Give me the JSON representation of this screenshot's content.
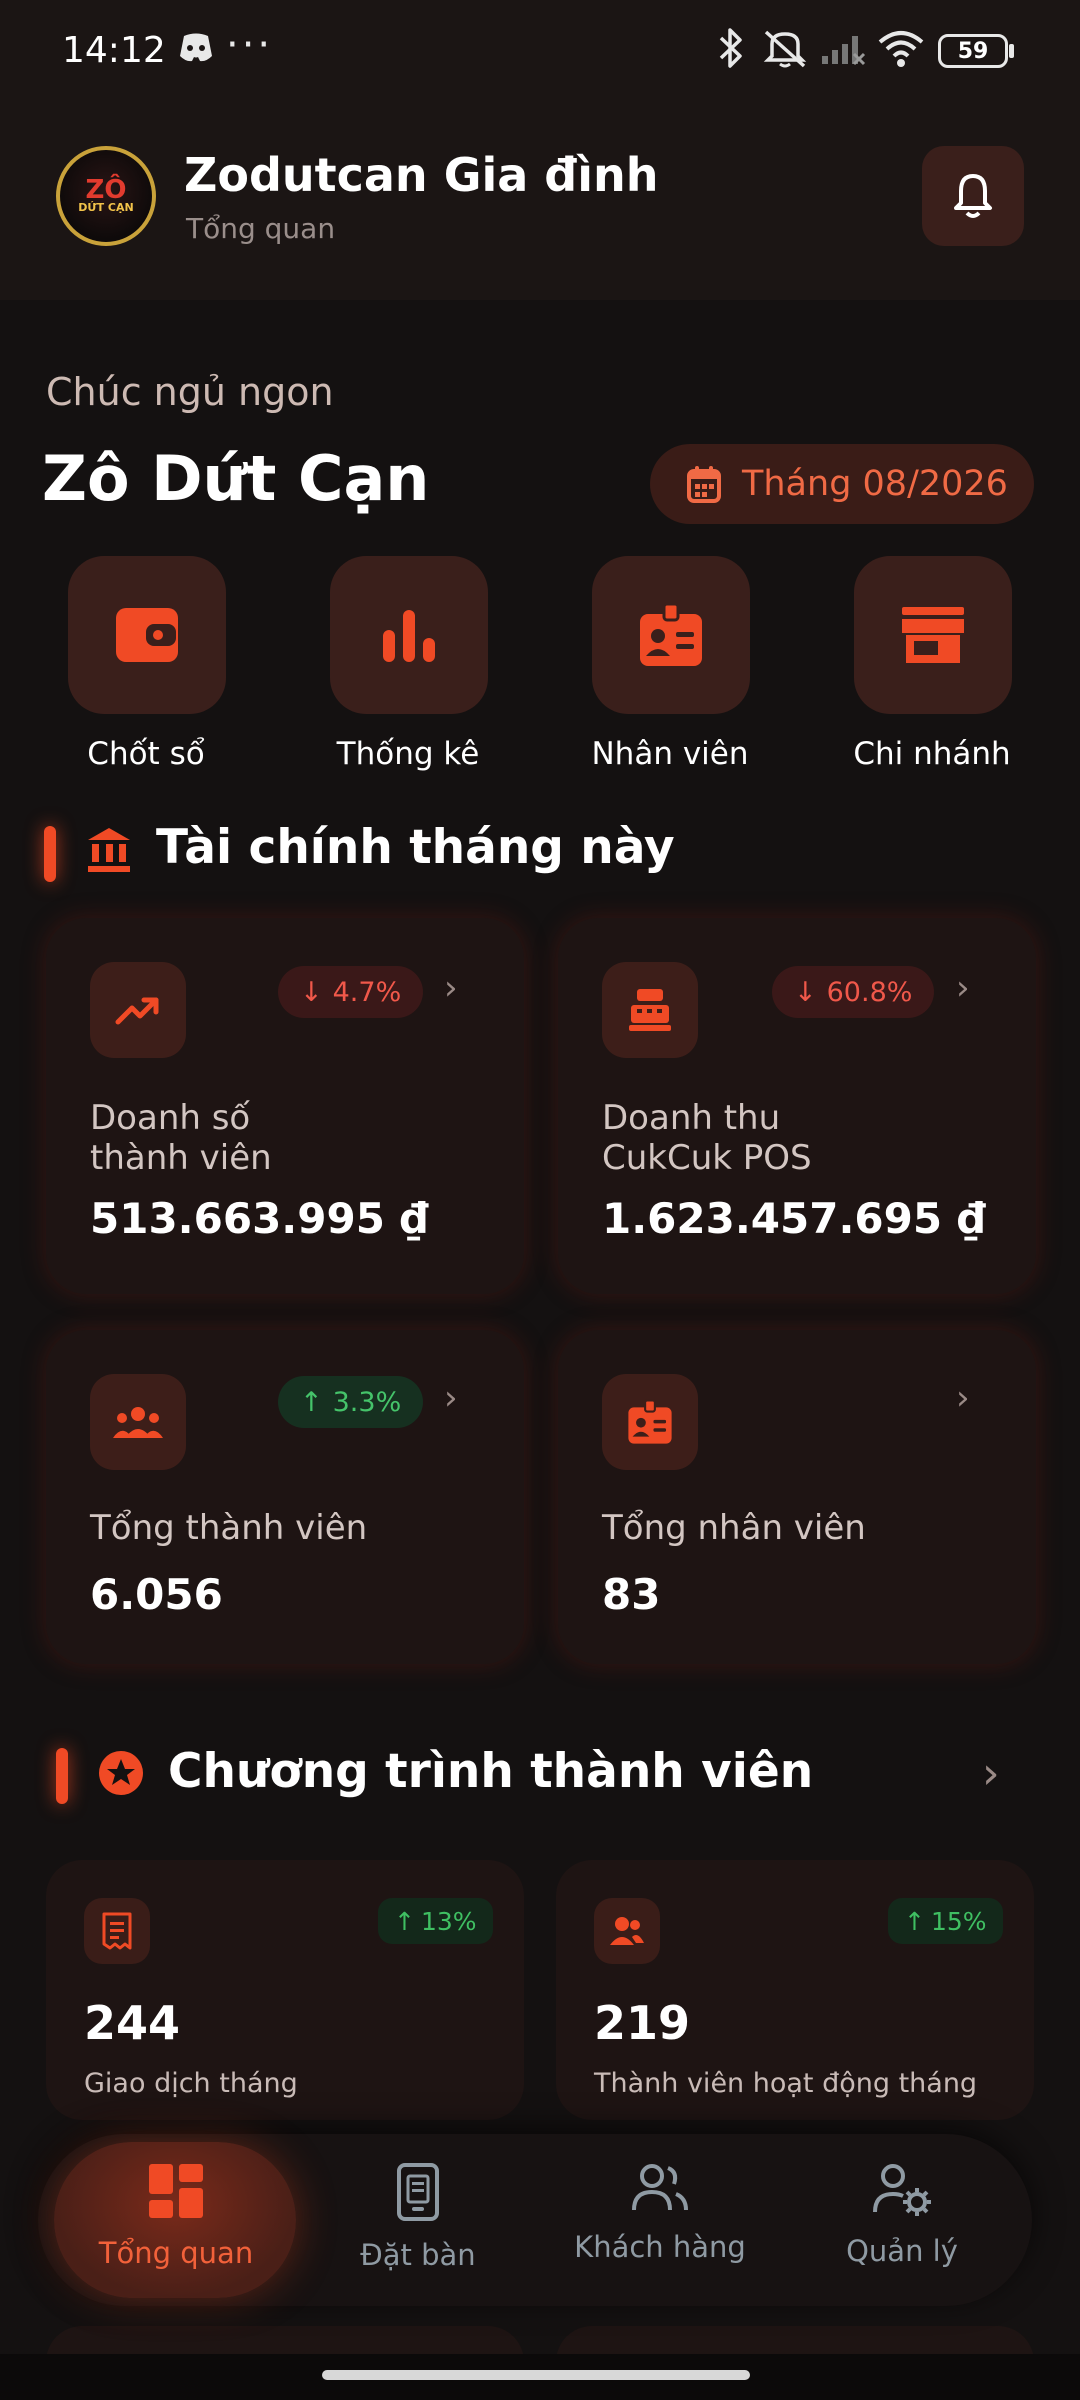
{
  "status_bar": {
    "time": "14:12",
    "left_icons": [
      "discord-icon",
      "more-dots-icon"
    ],
    "right_icons": [
      "bluetooth-icon",
      "mute-icon",
      "signal-icon",
      "wifi-icon",
      "battery-icon"
    ],
    "battery": "59"
  },
  "header": {
    "title": "Zodutcan Gia đình",
    "subtitle": "Tổng quan",
    "logo_text": "ZÔ",
    "logo_sub": "DỨT CẠN"
  },
  "greeting": {
    "text": "Chúc ngủ ngon",
    "name": "Zô Dứt Cạn",
    "month": "Tháng 08/2026"
  },
  "quick_actions": [
    {
      "label": "Chốt sổ",
      "icon": "wallet-icon"
    },
    {
      "label": "Thống kê",
      "icon": "bar-chart-icon"
    },
    {
      "label": "Nhân viên",
      "icon": "id-badge-icon"
    },
    {
      "label": "Chi nhánh",
      "icon": "store-icon"
    }
  ],
  "finance": {
    "title": "Tài chính tháng này",
    "cards": [
      {
        "label_1": "Doanh số",
        "label_2": "thành viên",
        "value": "513.663.995 ₫",
        "badge": "4.7%",
        "trend": "down",
        "icon": "trending-up-icon"
      },
      {
        "label_1": "Doanh thu",
        "label_2": "CukCuk POS",
        "value": "1.623.457.695 ₫",
        "badge": "60.8%",
        "trend": "down",
        "icon": "cash-register-icon"
      },
      {
        "label_1": "Tổng thành viên",
        "label_2": "",
        "value": "6.056",
        "badge": "3.3%",
        "trend": "up",
        "icon": "group-icon"
      },
      {
        "label_1": "Tổng nhân viên",
        "label_2": "",
        "value": "83",
        "badge": "",
        "trend": "",
        "icon": "id-badge-icon"
      }
    ]
  },
  "program": {
    "title": "Chương trình thành viên",
    "cards": [
      {
        "value": "244",
        "label": "Giao dịch tháng",
        "badge": "13%",
        "icon": "receipt-icon"
      },
      {
        "value": "219",
        "label": "Thành viên hoạt động tháng",
        "badge": "15%",
        "icon": "users-icon"
      }
    ]
  },
  "nav": {
    "items": [
      {
        "label": "Tổng quan",
        "icon": "dashboard-icon",
        "active": true
      },
      {
        "label": "Đặt bàn",
        "icon": "booking-icon",
        "active": false
      },
      {
        "label": "Khách hàng",
        "icon": "customers-icon",
        "active": false
      },
      {
        "label": "Quản lý",
        "icon": "manage-icon",
        "active": false
      }
    ]
  },
  "colors": {
    "accent": "#F04A25",
    "background": "#141111",
    "card": "#1E1413",
    "down": "#F0584A",
    "up": "#45C36A"
  }
}
